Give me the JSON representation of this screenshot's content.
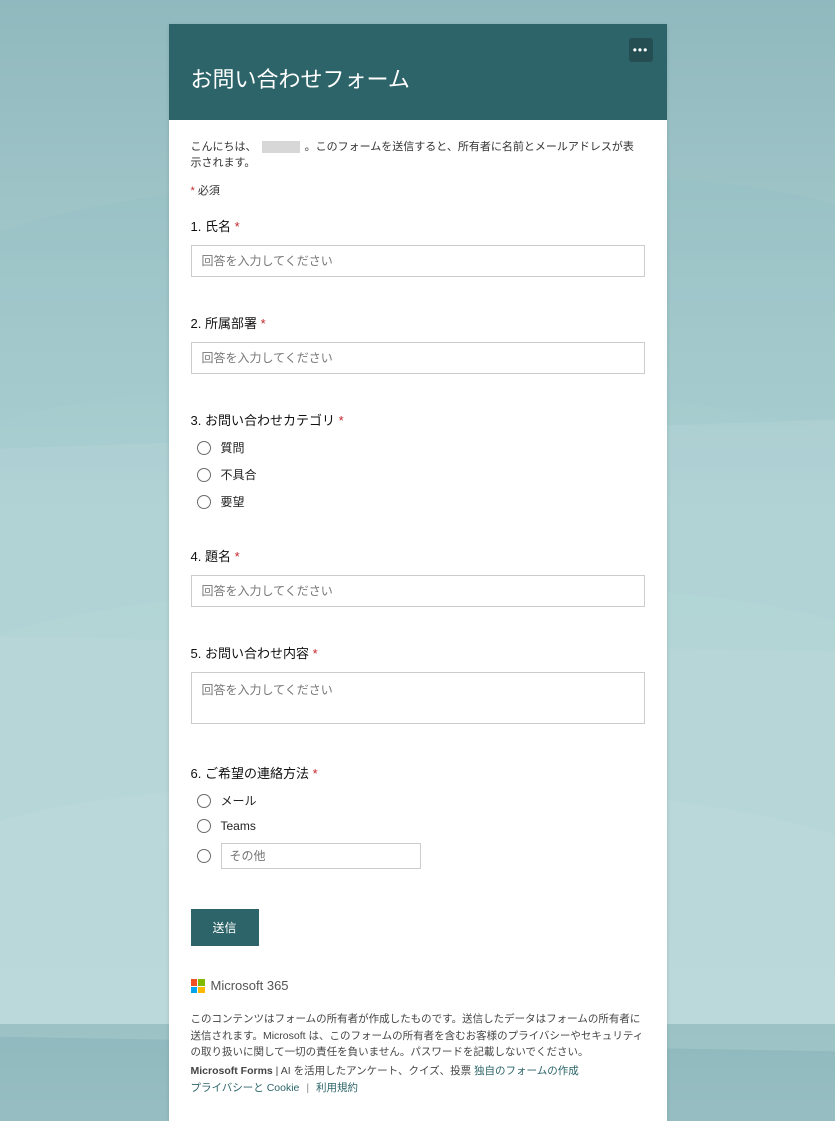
{
  "header": {
    "title": "お問い合わせフォーム"
  },
  "intro": {
    "greeting_prefix": "こんにちは、",
    "greeting_suffix": "。このフォームを送信すると、所有者に名前とメールアドレスが表示されます。",
    "required_label": "必須"
  },
  "questions": {
    "q1": {
      "number": "1.",
      "label": "氏名",
      "placeholder": "回答を入力してください"
    },
    "q2": {
      "number": "2.",
      "label": "所属部署",
      "placeholder": "回答を入力してください"
    },
    "q3": {
      "number": "3.",
      "label": "お問い合わせカテゴリ",
      "opts": {
        "a": "質問",
        "b": "不具合",
        "c": "要望"
      }
    },
    "q4": {
      "number": "4.",
      "label": "題名",
      "placeholder": "回答を入力してください"
    },
    "q5": {
      "number": "5.",
      "label": "お問い合わせ内容",
      "placeholder": "回答を入力してください"
    },
    "q6": {
      "number": "6.",
      "label": "ご希望の連絡方法",
      "opts": {
        "a": "メール",
        "b": "Teams",
        "c_placeholder": "その他"
      }
    }
  },
  "submit_label": "送信",
  "footer": {
    "brand": "Microsoft 365",
    "disclaimer": "このコンテンツはフォームの所有者が作成したものです。送信したデータはフォームの所有者に送信されます。Microsoft は、このフォームの所有者を含むお客様のプライバシーやセキュリティの取り扱いに関して一切の責任を負いません。パスワードを記載しないでください。",
    "forms_bold": "Microsoft Forms",
    "forms_text": " | AI を活用したアンケート、クイズ、投票 ",
    "forms_link": "独自のフォームの作成",
    "privacy_link": "プライバシーと Cookie",
    "terms_link": "利用規約"
  }
}
